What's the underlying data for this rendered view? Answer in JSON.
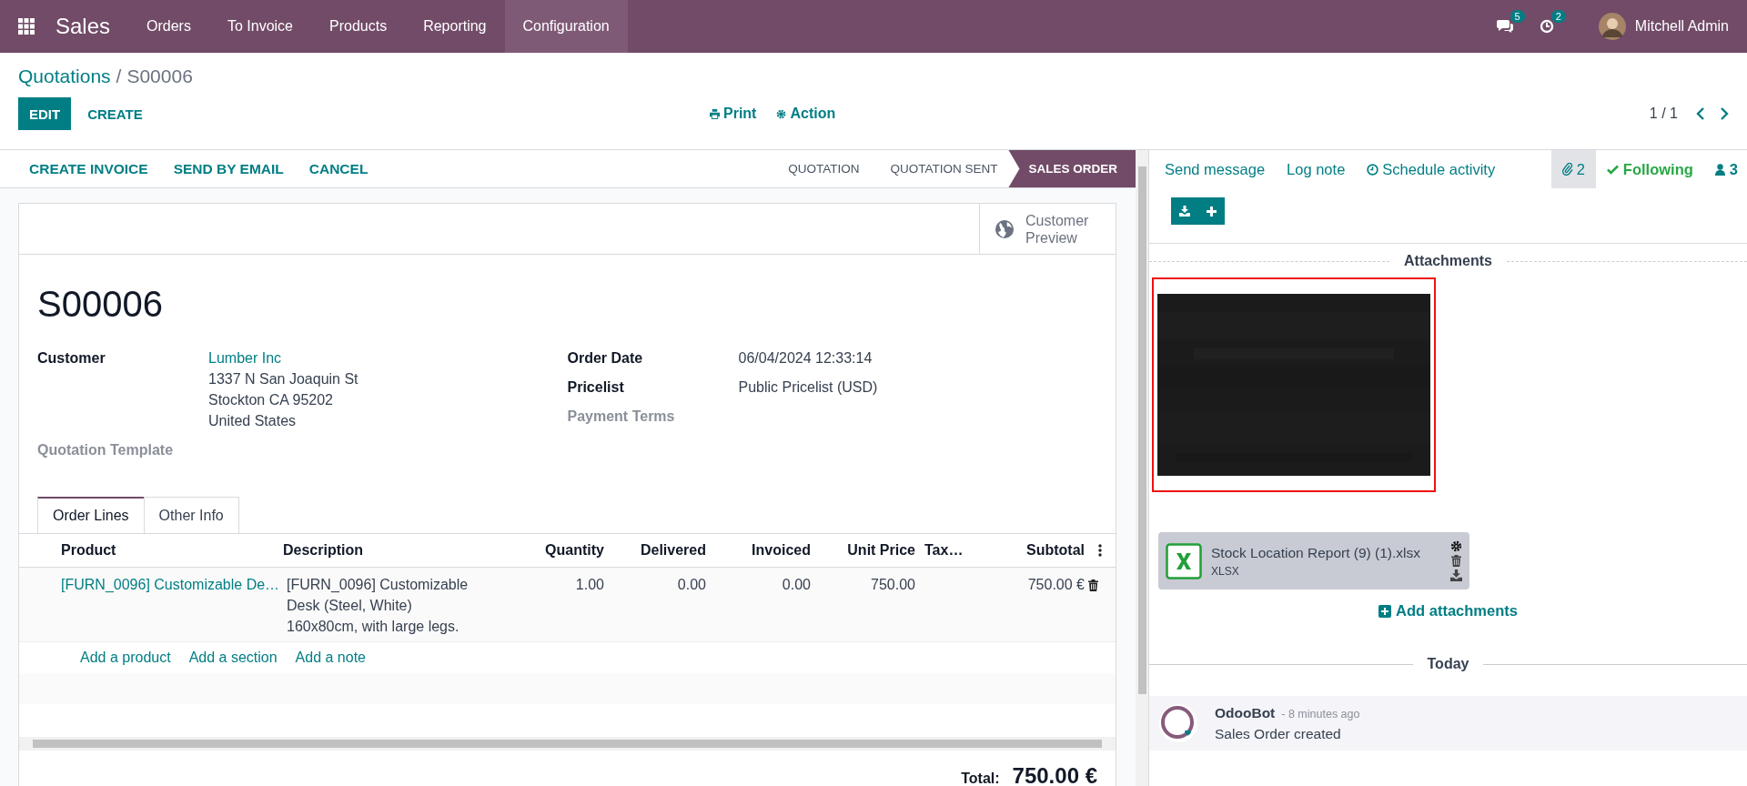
{
  "navbar": {
    "app": "Sales",
    "menu": [
      {
        "label": "Orders",
        "selected": false
      },
      {
        "label": "To Invoice",
        "selected": false
      },
      {
        "label": "Products",
        "selected": false
      },
      {
        "label": "Reporting",
        "selected": false
      },
      {
        "label": "Configuration",
        "selected": true
      }
    ],
    "messages_badge": "5",
    "activities_badge": "2",
    "user": "Mitchell Admin"
  },
  "breadcrumb": {
    "parent": "Quotations",
    "separator": "/",
    "current": "S00006"
  },
  "control_panel": {
    "buttons": [
      {
        "label": "EDIT",
        "kind": "primary"
      },
      {
        "label": "CREATE",
        "kind": "secondary"
      }
    ],
    "actions": [
      {
        "label": "Print",
        "kind": "print"
      },
      {
        "label": "Action",
        "kind": "gear"
      }
    ],
    "pager": "1 / 1"
  },
  "statusbar": {
    "buttons": [
      "CREATE INVOICE",
      "SEND BY EMAIL",
      "CANCEL"
    ],
    "stages": [
      {
        "label": "QUOTATION",
        "selected": false
      },
      {
        "label": "QUOTATION SENT",
        "selected": false
      },
      {
        "label": "SALES ORDER",
        "selected": true
      }
    ]
  },
  "sheet": {
    "smart_button": "Customer Preview",
    "name": "S00006",
    "left_fields": [
      {
        "label": "Customer",
        "required": true,
        "link": "Lumber Inc",
        "lines": [
          "1337 N San Joaquin St",
          "Stockton CA 95202",
          "United States"
        ]
      },
      {
        "label": "Quotation Template",
        "required": false
      }
    ],
    "right_fields": [
      {
        "label": "Order Date",
        "required": true,
        "lines": [
          "06/04/2024 12:33:14"
        ]
      },
      {
        "label": "Pricelist",
        "required": true,
        "lines": [
          "Public Pricelist (USD)"
        ]
      },
      {
        "label": "Payment Terms",
        "required": false
      }
    ],
    "tabs": [
      {
        "label": "Order Lines",
        "selected": true
      },
      {
        "label": "Other Info",
        "selected": false
      }
    ],
    "table": {
      "columns": [
        "Product",
        "Description",
        "Quantity",
        "Delivered",
        "Invoiced",
        "Unit Price",
        "Tax…",
        "Subtotal"
      ],
      "rows": [
        {
          "product": "[FURN_0096] Customizable De…",
          "description": [
            "[FURN_0096] Customizable",
            "Desk (Steel, White)",
            "160x80cm, with large legs."
          ],
          "quantity": "1.00",
          "delivered": "0.00",
          "invoiced": "0.00",
          "unit_price": "750.00",
          "subtotal": "750.00 €"
        }
      ],
      "add_links": [
        "Add a product",
        "Add a section",
        "Add a note"
      ]
    },
    "total": {
      "label": "Total:",
      "value": "750.00 €"
    }
  },
  "chatter": {
    "actions": [
      {
        "label": "Send message",
        "kind": "plain"
      },
      {
        "label": "Log note",
        "kind": "plain"
      },
      {
        "label": "Schedule activity",
        "kind": "clock"
      }
    ],
    "attachment_count": {
      "label": "2",
      "selected": true
    },
    "following": {
      "label": "Following",
      "on": true
    },
    "followers": "3",
    "attachments_title": "Attachments",
    "image_attachment": {
      "kind": "picture",
      "highlighted": true
    },
    "file_attachment": {
      "name": "Stock Location Report (9) (1).xlsx",
      "type": "XLSX"
    },
    "add_attachments": "Add attachments",
    "day": "Today",
    "messages": [
      {
        "author": "OdooBot",
        "time": "- 8 minutes ago",
        "body": "Sales Order created"
      }
    ]
  }
}
